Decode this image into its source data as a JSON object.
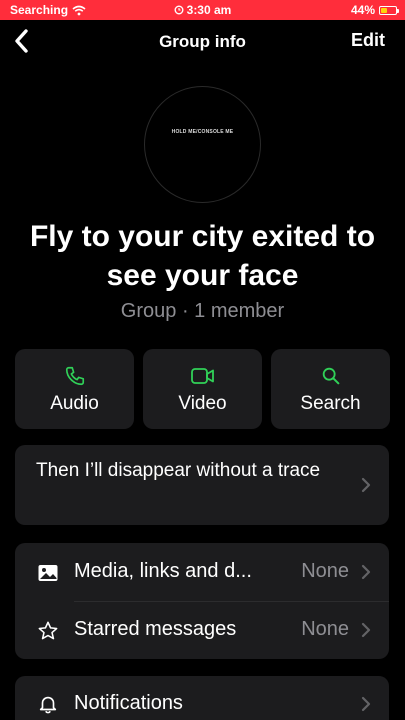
{
  "status_bar": {
    "carrier": "Searching",
    "time": "3:30 am",
    "battery": "44%",
    "battery_level": 0.44
  },
  "nav": {
    "title": "Group info",
    "edit_label": "Edit"
  },
  "avatar": {
    "text": "HOLD ME/CONSOLE ME"
  },
  "group": {
    "name": "Fly to your city exited to see your face",
    "subtitle": "Group · 1 member"
  },
  "actions": [
    {
      "label": "Audio",
      "icon": "phone-icon"
    },
    {
      "label": "Video",
      "icon": "video-icon"
    },
    {
      "label": "Search",
      "icon": "search-icon"
    }
  ],
  "description": "Then I’ll disappear without a trace",
  "rows": [
    {
      "label": "Media, links and d...",
      "value": "None",
      "icon": "image-icon"
    },
    {
      "label": "Starred messages",
      "value": "None",
      "icon": "star-icon"
    },
    {
      "label": "Notifications",
      "value": "",
      "icon": "bell-icon"
    }
  ],
  "colors": {
    "accent": "#30d158",
    "status_bar": "#ff2d3b",
    "card": "#1c1c1e",
    "secondary_text": "#8e8e93"
  }
}
